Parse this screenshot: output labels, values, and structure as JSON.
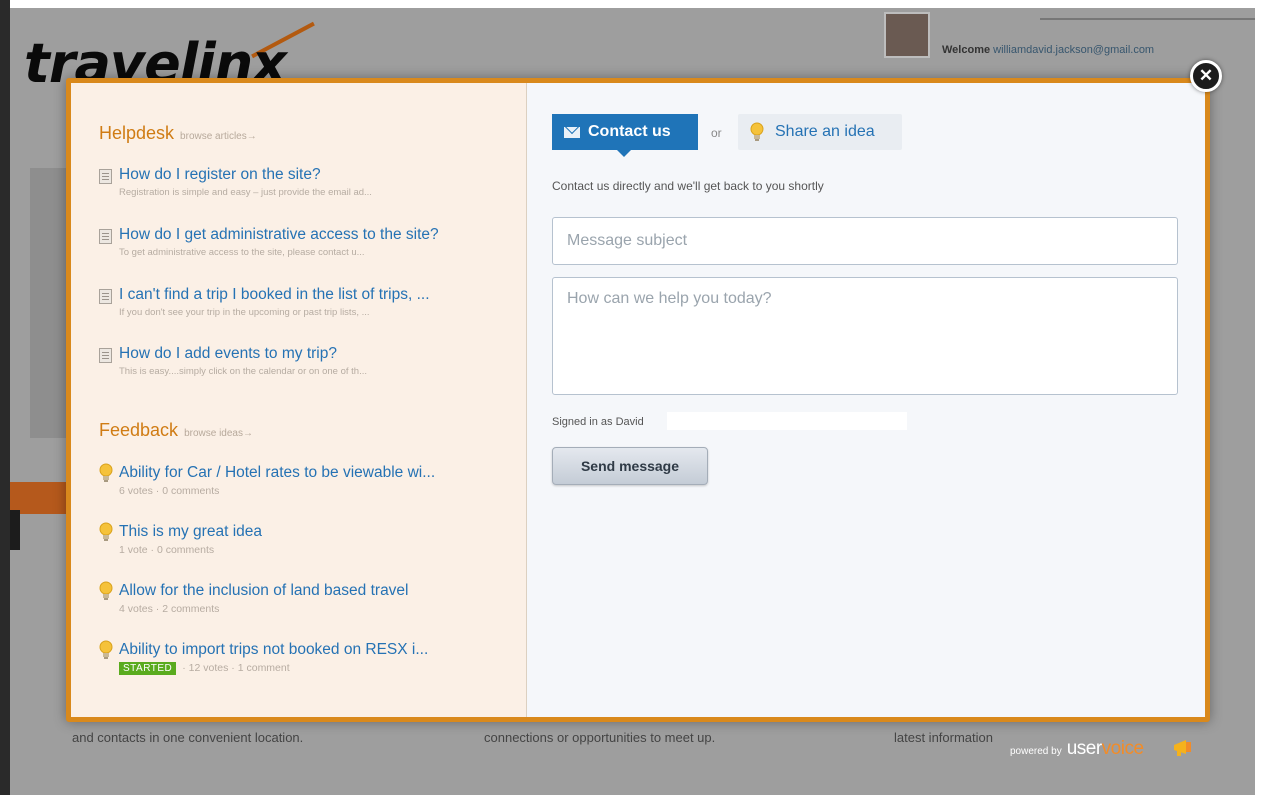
{
  "background": {
    "logo_text": "travelinx",
    "welcome_label": "Welcome",
    "welcome_email": "williamdavid.jackson@gmail.com",
    "footer_texts": [
      "and contacts in one convenient location.",
      "connections or opportunities to meet up.",
      "latest information"
    ]
  },
  "helpdesk": {
    "title": "Helpdesk",
    "browse_link": "browse articles→",
    "articles": [
      {
        "title": "How do I register on the site?",
        "snippet": "Registration is simple and easy – just provide the email ad..."
      },
      {
        "title": "How do I get administrative access to the site?",
        "snippet": "To get administrative access to the site, please contact u..."
      },
      {
        "title": "I can't find a trip I booked in the list of trips, ...",
        "snippet": "If you don't see your trip in the upcoming or past trip lists, ..."
      },
      {
        "title": "How do I add events to my trip?",
        "snippet": "This is easy....simply click on the calendar or on one of th..."
      }
    ]
  },
  "feedback": {
    "title": "Feedback",
    "browse_link": "browse ideas→",
    "ideas": [
      {
        "title": "Ability for Car / Hotel rates to be viewable wi...",
        "votes": "6 votes",
        "comments": "0 comments",
        "status": ""
      },
      {
        "title": "This is my great idea",
        "votes": "1 vote",
        "comments": "0 comments",
        "status": ""
      },
      {
        "title": "Allow for the inclusion of land based travel",
        "votes": "4 votes",
        "comments": "2 comments",
        "status": ""
      },
      {
        "title": "Ability to import trips not booked on RESX i...",
        "votes": "12 votes",
        "comments": "1 comment",
        "status": "STARTED"
      }
    ]
  },
  "contact": {
    "contact_tab_label": "Contact us",
    "or_label": "or",
    "idea_tab_label": "Share an idea",
    "description": "Contact us directly and we'll get back to you shortly",
    "subject_placeholder": "Message subject",
    "message_placeholder": "How can we help you today?",
    "signed_in_text": "Signed in as David",
    "send_label": "Send message"
  },
  "close_label": "✕",
  "branding": {
    "powered_by": "powered by",
    "brand_main": "user",
    "brand_accent": "voice"
  },
  "colors": {
    "modal_border": "#d9891c",
    "section_title": "#d07c14",
    "link": "#2572b4",
    "contact_tab": "#1f74b8",
    "started_badge": "#5aab1e"
  },
  "icons": {
    "article": "document-icon",
    "idea": "lightbulb-icon",
    "contact": "envelope-icon",
    "close": "close-icon",
    "brand": "megaphone-icon"
  }
}
